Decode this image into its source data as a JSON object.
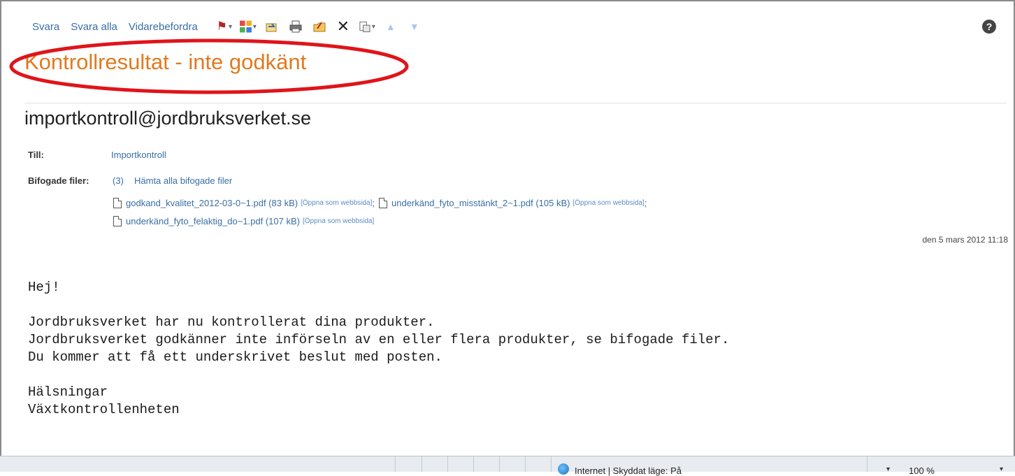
{
  "toolbar": {
    "reply": "Svara",
    "reply_all": "Svara alla",
    "forward": "Vidarebefordra",
    "icons": [
      "flag-icon",
      "categorize-icon",
      "move-icon",
      "print-icon",
      "open-icon",
      "delete-icon",
      "options-icon",
      "previous-icon",
      "next-icon"
    ],
    "help": "?"
  },
  "message": {
    "subject": "Kontrollresultat - inte godkänt",
    "sender": "importkontroll@jordbruksverket.se",
    "to_label": "Till:",
    "to_value": "Importkontroll",
    "attachments_label": "Bifogade filer:",
    "attachments_count": "(3)",
    "download_all": "Hämta alla bifogade filer",
    "attachments": [
      {
        "name": "godkand_kvalitet_2012-03-0~1.pdf (83 kB)",
        "open": "[Öppna som webbsida]",
        "sep": ";"
      },
      {
        "name": "underkänd_fyto_misstänkt_2~1.pdf (105 kB)",
        "open": "[Öppna som webbsida]",
        "sep": ";"
      },
      {
        "name": "underkänd_fyto_felaktig_do~1.pdf (107 kB)",
        "open": "[Öppna som webbsida]",
        "sep": ""
      }
    ],
    "date": "den 5 mars 2012 11:18",
    "body": "Hej!\n\nJordbruksverket har nu kontrollerat dina produkter.\nJordbruksverket godkänner inte införseln av en eller flera produkter, se bifogade filer.\nDu kommer att få ett underskrivet beslut med posten.\n\nHälsningar\nVäxtkontrollenheten"
  },
  "statusbar": {
    "zone": "Internet | Skyddat läge: På",
    "zoom": "100 %"
  },
  "colors": {
    "subject": "#e07a20",
    "link": "#3a6ea5",
    "annotation": "#e0141a"
  }
}
